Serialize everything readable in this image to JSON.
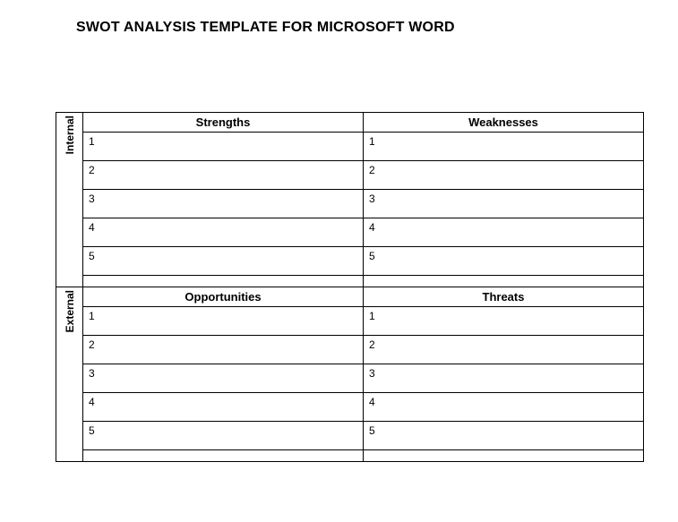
{
  "title": "SWOT ANALYSIS TEMPLATE FOR MICROSOFT WORD",
  "rows": {
    "internal": "Internal",
    "external": "External"
  },
  "quadrants": {
    "strengths": {
      "label": "Strengths",
      "items": [
        "1",
        "2",
        "3",
        "4",
        "5"
      ]
    },
    "weaknesses": {
      "label": "Weaknesses",
      "items": [
        "1",
        "2",
        "3",
        "4",
        "5"
      ]
    },
    "opportunities": {
      "label": "Opportunities",
      "items": [
        "1",
        "2",
        "3",
        "4",
        "5"
      ]
    },
    "threats": {
      "label": "Threats",
      "items": [
        "1",
        "2",
        "3",
        "4",
        "5"
      ]
    }
  }
}
